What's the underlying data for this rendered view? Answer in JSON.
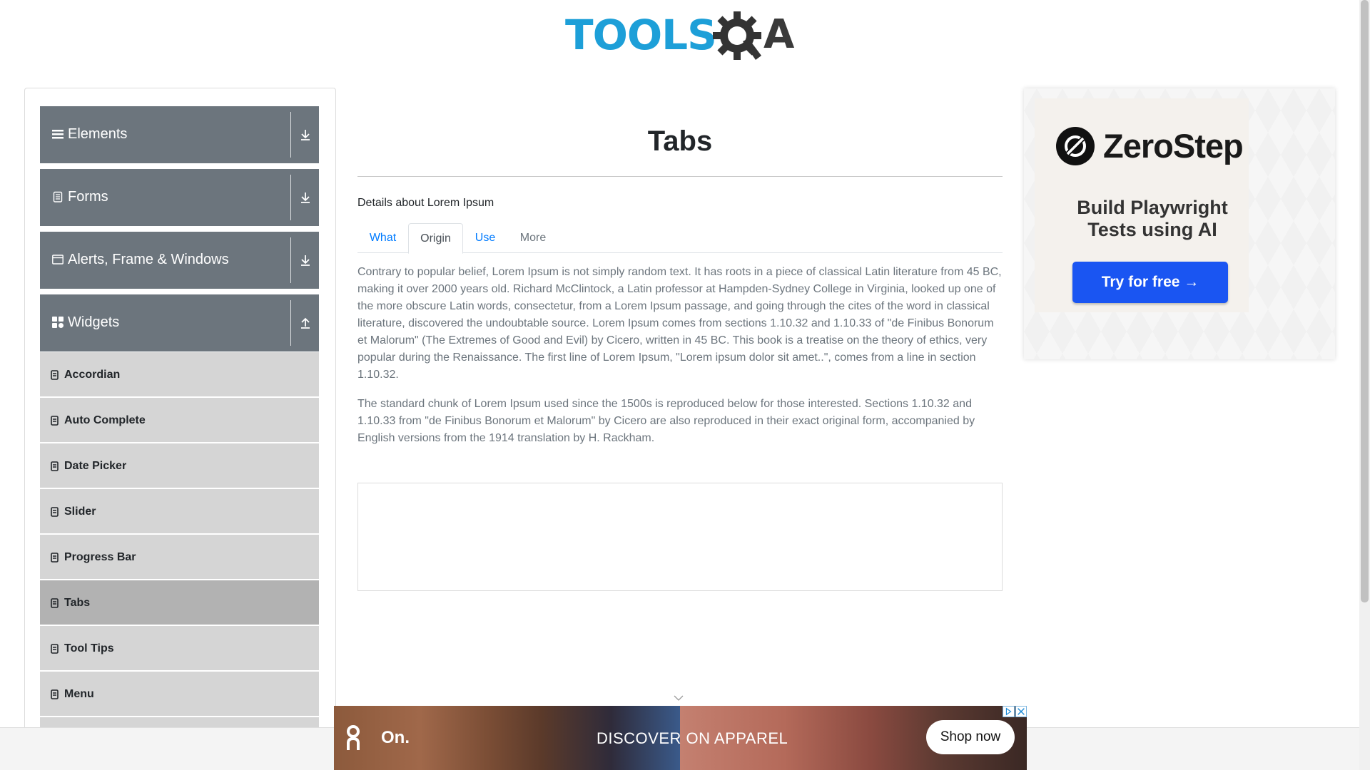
{
  "logo": {
    "text": "TOOLS",
    "letter": "A",
    "gear_color": "#333333",
    "text_color": "#1d9fd8"
  },
  "sidebar": {
    "groups": [
      {
        "label": "Elements",
        "icon": "list-icon",
        "toggle": "download-arrow-icon"
      },
      {
        "label": "Forms",
        "icon": "clipboard-icon",
        "toggle": "download-arrow-icon"
      },
      {
        "label": "Alerts, Frame & Windows",
        "icon": "window-icon",
        "toggle": "download-arrow-icon"
      },
      {
        "label": "Widgets",
        "icon": "grid-icon",
        "toggle": "upload-arrow-icon"
      }
    ],
    "items": [
      {
        "label": "Accordian",
        "active": false
      },
      {
        "label": "Auto Complete",
        "active": false
      },
      {
        "label": "Date Picker",
        "active": false
      },
      {
        "label": "Slider",
        "active": false
      },
      {
        "label": "Progress Bar",
        "active": false
      },
      {
        "label": "Tabs",
        "active": true
      },
      {
        "label": "Tool Tips",
        "active": false
      },
      {
        "label": "Menu",
        "active": false
      }
    ]
  },
  "main": {
    "title": "Tabs",
    "subhead": "Details about Lorem Ipsum",
    "tabs": [
      {
        "label": "What",
        "state": "link"
      },
      {
        "label": "Origin",
        "state": "active"
      },
      {
        "label": "Use",
        "state": "link"
      },
      {
        "label": "More",
        "state": "disabled"
      }
    ],
    "paragraphs": [
      "Contrary to popular belief, Lorem Ipsum is not simply random text. It has roots in a piece of classical Latin literature from 45 BC, making it over 2000 years old. Richard McClintock, a Latin professor at Hampden-Sydney College in Virginia, looked up one of the more obscure Latin words, consectetur, from a Lorem Ipsum passage, and going through the cites of the word in classical literature, discovered the undoubtable source. Lorem Ipsum comes from sections 1.10.32 and 1.10.33 of \"de Finibus Bonorum et Malorum\" (The Extremes of Good and Evil) by Cicero, written in 45 BC. This book is a treatise on the theory of ethics, very popular during the Renaissance. The first line of Lorem Ipsum, \"Lorem ipsum dolor sit amet..\", comes from a line in section 1.10.32.",
      "The standard chunk of Lorem Ipsum used since the 1500s is reproduced below for those interested. Sections 1.10.32 and 1.10.33 from \"de Finibus Bonorum et Malorum\" by Cicero are also reproduced in their exact original form, accompanied by English versions from the 1914 translation by H. Rackham."
    ]
  },
  "right_ad": {
    "brand": "ZeroStep",
    "headline_line1": "Build Playwright",
    "headline_line2": "Tests using AI",
    "cta": "Try for free →",
    "cta_color": "#1a55f2"
  },
  "banner_ad": {
    "brand_icon": "on-logo-icon",
    "brand": "On.",
    "copy": "DISCOVER ON APPAREL",
    "cta": "Shop now"
  },
  "colors": {
    "group_header_bg": "#6c757d",
    "menu_item_bg": "#d5d5d5",
    "menu_item_active_bg": "#b2b2b2",
    "tab_link": "#007bff"
  }
}
